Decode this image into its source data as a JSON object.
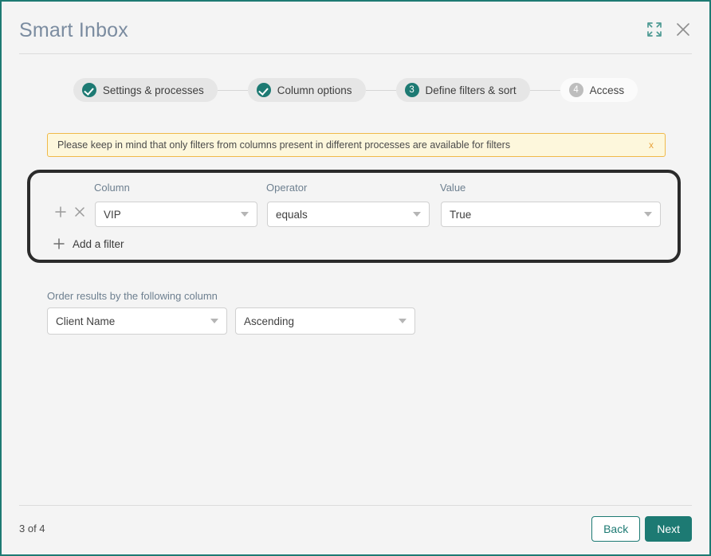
{
  "window": {
    "title": "Smart Inbox",
    "expand_icon": "expand-icon",
    "close_icon": "close-icon",
    "border_color": "#1d7a73",
    "background": "#f4f4f4"
  },
  "stepper": {
    "accent_color": "#1d7a73",
    "steps": [
      {
        "badge": "check",
        "label": "Settings & processes",
        "state": "completed"
      },
      {
        "badge": "check",
        "label": "Column options",
        "state": "completed"
      },
      {
        "badge": "3",
        "label": "Define filters & sort",
        "state": "active"
      },
      {
        "badge": "4",
        "label": "Access",
        "state": "upcoming"
      }
    ]
  },
  "banner": {
    "message": "Please keep in mind that only filters from columns present in different processes are available for filters",
    "close_label": "x",
    "background": "#fdf7dc",
    "border_color": "#f0b949",
    "close_color": "#e8a33d"
  },
  "filters": {
    "highlight_color": "#2b2b2b",
    "headers": {
      "column": "Column",
      "operator": "Operator",
      "value": "Value"
    },
    "rows": [
      {
        "add_icon": "plus-icon",
        "remove_icon": "close-icon",
        "column": "VIP",
        "operator": "equals",
        "value": "True"
      }
    ],
    "add_filter": {
      "icon": "plus-icon",
      "label": "Add a filter"
    }
  },
  "order_by": {
    "label": "Order results by the following column",
    "column": "Client Name",
    "direction": "Ascending"
  },
  "footer": {
    "page_count": "3 of 4",
    "back_label": "Back",
    "next_label": "Next",
    "primary_color": "#1d7a73"
  }
}
